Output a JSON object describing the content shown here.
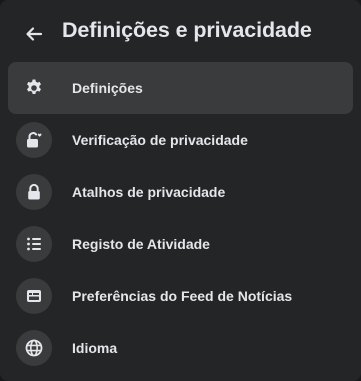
{
  "header": {
    "title": "Definições e privacidade",
    "back_icon": "arrow-left-icon"
  },
  "menu": {
    "items": [
      {
        "label": "Definições",
        "icon": "gear-icon",
        "active": true
      },
      {
        "label": "Verificação de privacidade",
        "icon": "lock-heart-icon",
        "active": false
      },
      {
        "label": "Atalhos de privacidade",
        "icon": "lock-icon",
        "active": false
      },
      {
        "label": "Registo de Atividade",
        "icon": "list-icon",
        "active": false
      },
      {
        "label": "Preferências do Feed de Notícias",
        "icon": "feed-icon",
        "active": false
      },
      {
        "label": "Idioma",
        "icon": "globe-icon",
        "active": false
      }
    ]
  },
  "colors": {
    "background": "#242526",
    "active_row": "#3a3b3c",
    "icon_circle": "#3a3b3c",
    "text": "#e4e6eb"
  }
}
